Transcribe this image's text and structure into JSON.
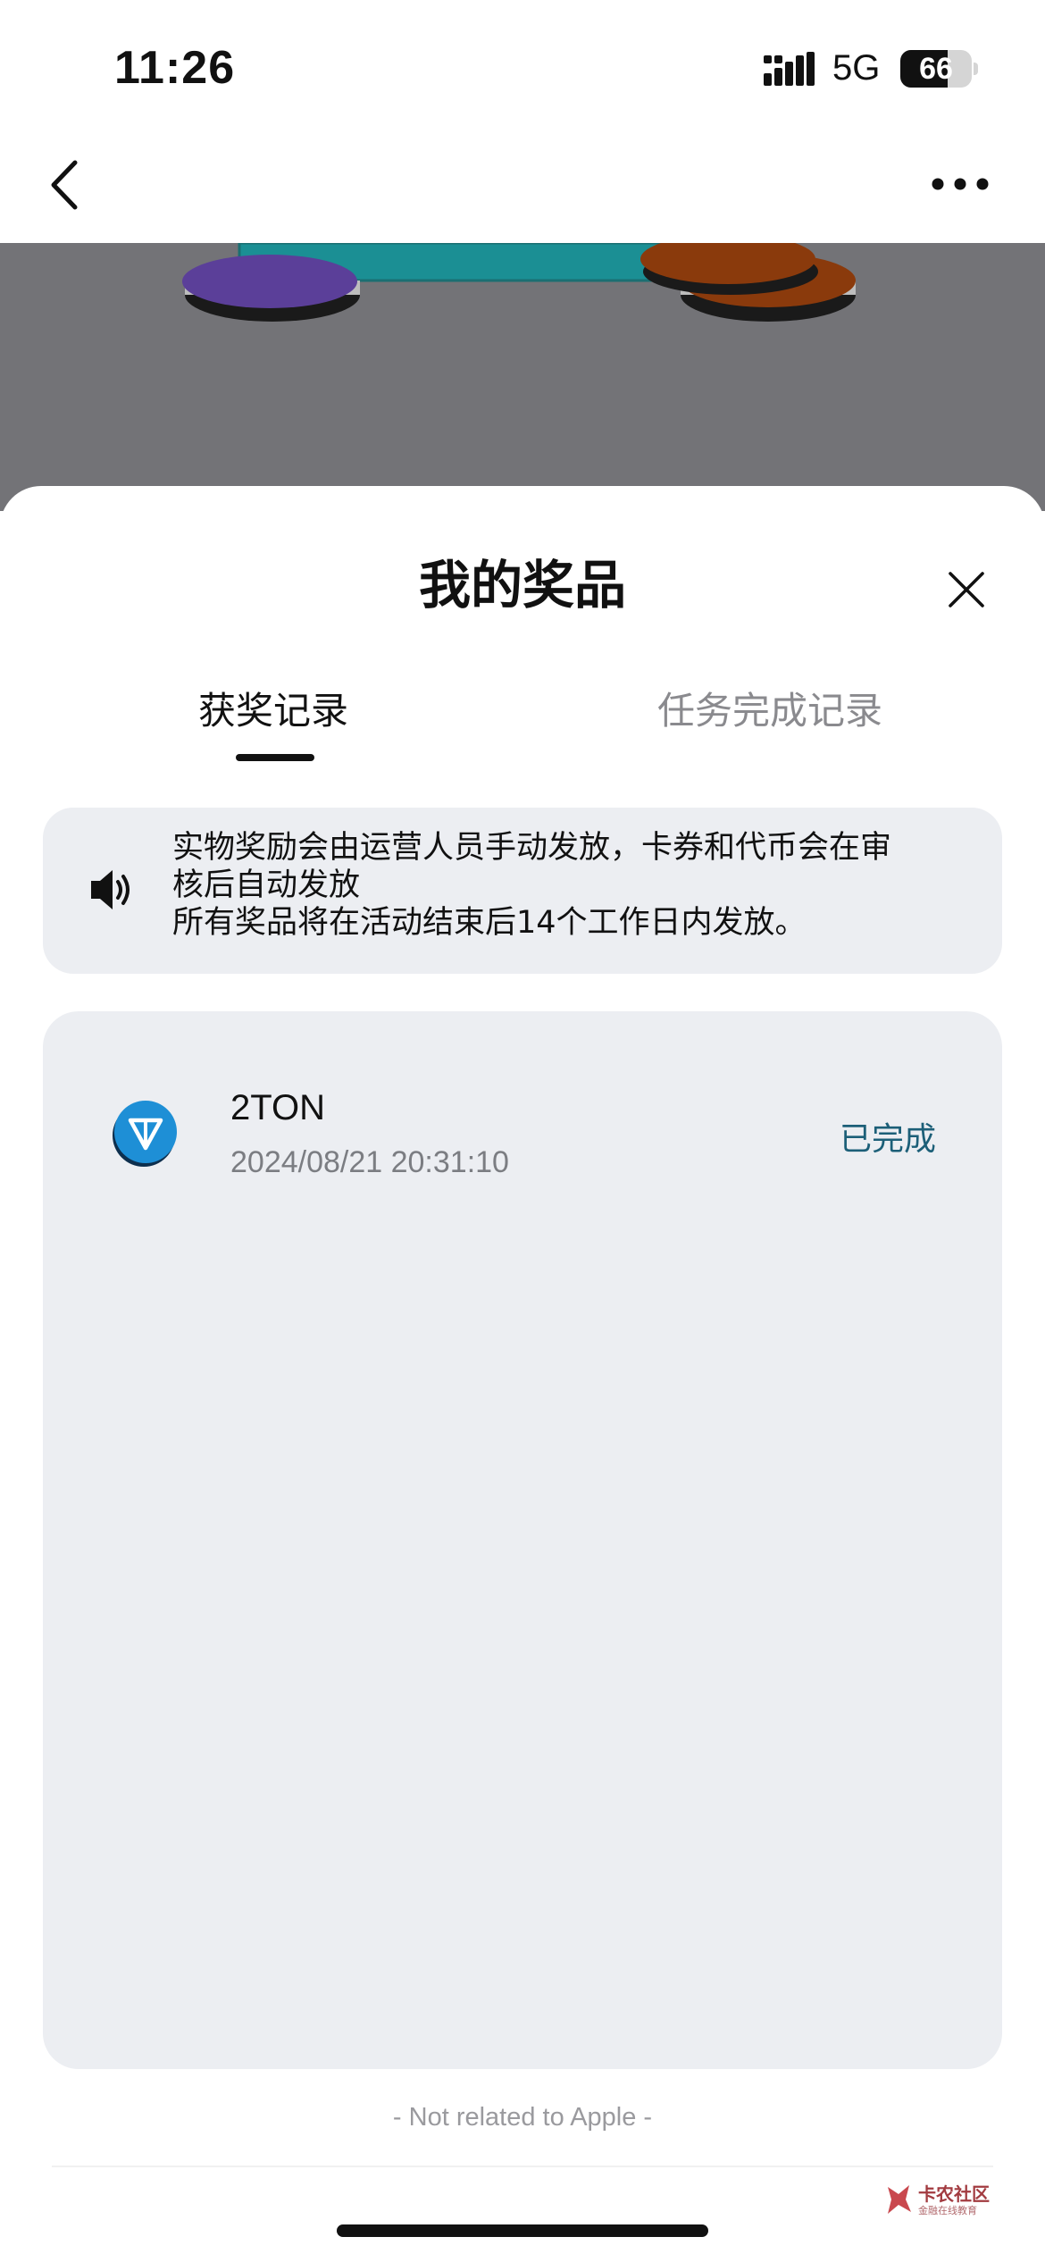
{
  "status_bar": {
    "time": "11:26",
    "network": "5G",
    "battery_level": 66,
    "battery_label": "66"
  },
  "nav": {
    "back_icon": "chevron-left-icon",
    "more_icon": "ellipsis-icon"
  },
  "sheet": {
    "title": "我的奖品",
    "close_icon": "close-icon",
    "tabs": [
      {
        "label": "获奖记录",
        "active": true
      },
      {
        "label": "任务完成记录",
        "active": false
      }
    ],
    "notice": {
      "icon": "speaker-icon",
      "lines": [
        "实物奖励会由运营人员手动发放，卡券和代币会在审",
        "核后自动发放",
        "所有奖品将在活动结束后14个工作日内发放。"
      ]
    },
    "records": [
      {
        "icon": "ton-icon",
        "name": "2TON",
        "time": "2024/08/21 20:31:10",
        "status": "已完成"
      }
    ]
  },
  "footer": {
    "note": "- Not related to Apple -"
  },
  "watermark": {
    "main": "卡农社区",
    "sub": "金融在线教育"
  },
  "colors": {
    "banner": "#737377",
    "card_bg": "#eceef2",
    "status_done": "#1c5f78",
    "ton_blue": "#1e8fd6",
    "purple_coin": "#5b3f99",
    "orange_coin": "#8a3a0c",
    "teal_block": "#1b8f94"
  }
}
